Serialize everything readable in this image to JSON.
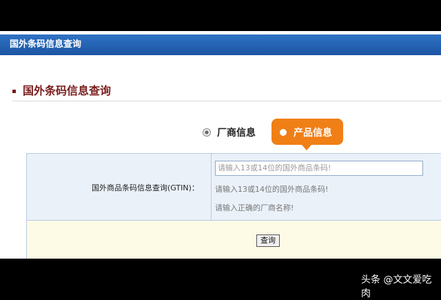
{
  "window": {
    "title": "国外条码信息查询"
  },
  "section": {
    "title": "国外条码信息查询"
  },
  "radio": {
    "manufacturer_label": "厂商信息",
    "product_label": "产品信息"
  },
  "form": {
    "field_label": "国外商品条码信息查询(GTIN)：",
    "input_placeholder": "请输入13或14位的国外商品条码!",
    "hint_product": "请输入13或14位的国外商品条码!",
    "hint_manufacturer": "请输入正确的厂商名称!",
    "submit_label": "查询"
  },
  "watermark": "头条 @文文爱吃肉",
  "colors": {
    "titlebar": "#1c55a3",
    "accent": "#f07f16",
    "section_title": "#7a1d1d"
  }
}
